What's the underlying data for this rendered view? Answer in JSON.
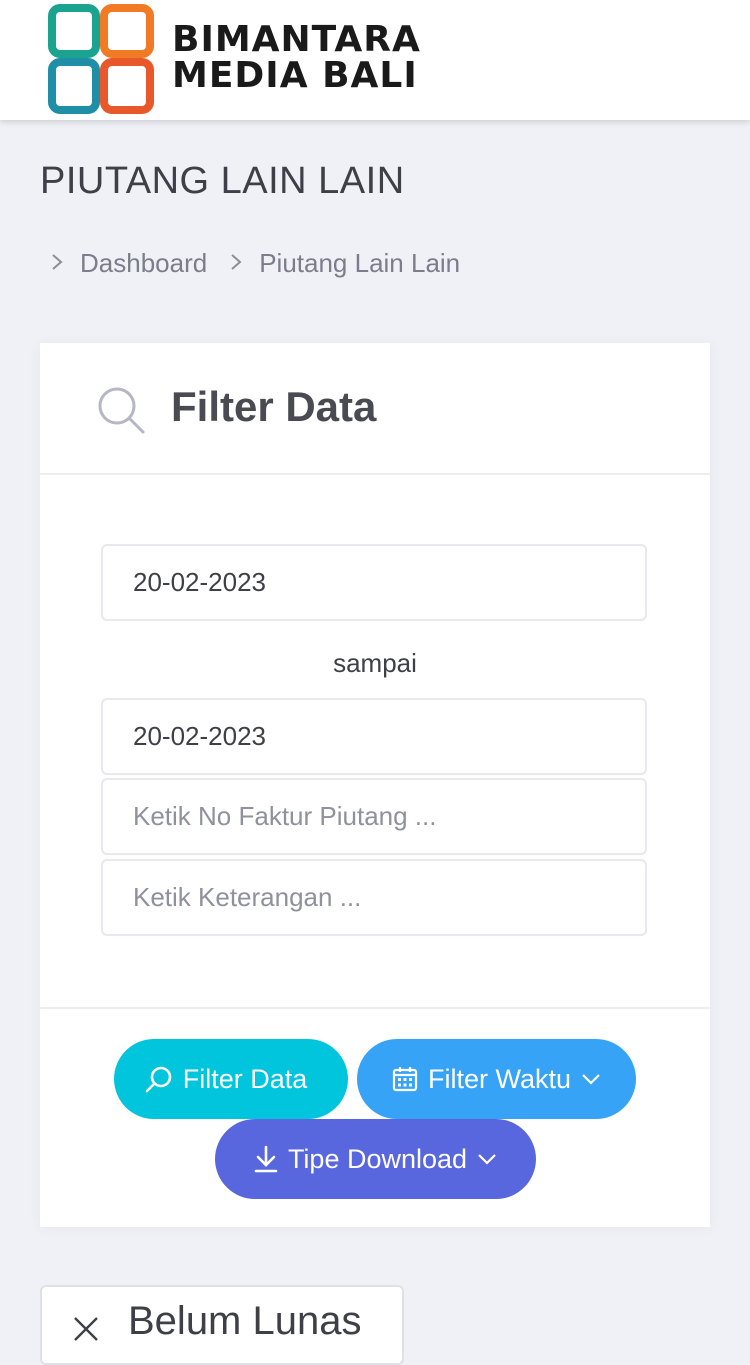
{
  "header": {
    "brand_line1": "BIMANTARA",
    "brand_line2": "MEDIA BALI",
    "logo_colors": [
      "#1aa38f",
      "#f07b24",
      "#1e8fa6",
      "#e8582a"
    ]
  },
  "page_title": "PIUTANG LAIN LAIN",
  "breadcrumb": {
    "items": [
      {
        "label": "Dashboard"
      },
      {
        "label": "Piutang Lain Lain"
      }
    ]
  },
  "filter_card": {
    "title": "Filter Data",
    "date_from": "20-02-2023",
    "separator_text": "sampai",
    "date_to": "20-02-2023",
    "invoice_placeholder": "Ketik No Faktur Piutang ...",
    "note_placeholder": "Ketik Keterangan ..."
  },
  "buttons": {
    "filter_data": {
      "label": "Filter Data",
      "icon": "search-icon",
      "color": "#00c5dc"
    },
    "filter_waktu": {
      "label": "Filter Waktu",
      "icon": "calendar-icon",
      "color": "#36a3f7"
    },
    "tipe_download": {
      "label": "Tipe Download",
      "icon": "download-icon",
      "color": "#5867dd"
    }
  },
  "status_tag": {
    "label": "Belum Lunas",
    "icon": "close-icon"
  }
}
